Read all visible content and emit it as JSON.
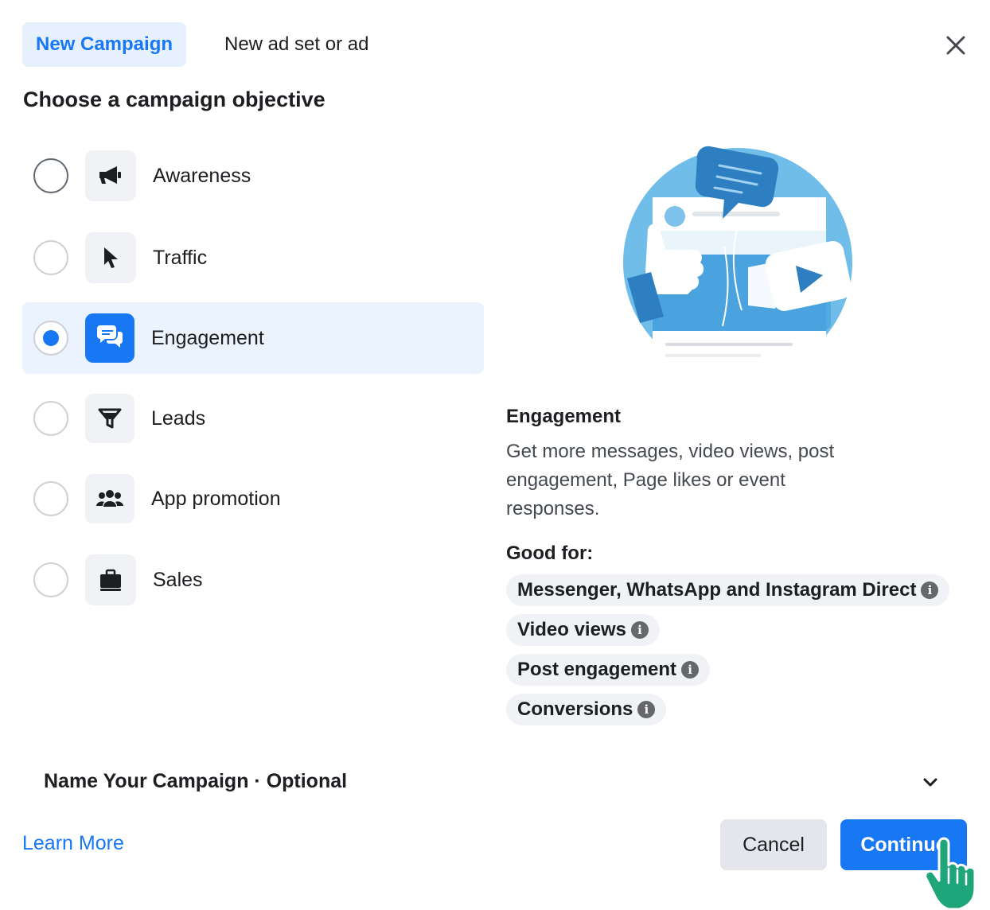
{
  "tabs": {
    "active": "New Campaign",
    "inactive": "New ad set or ad"
  },
  "close_icon": "close-icon",
  "heading": "Choose a campaign objective",
  "objectives": [
    {
      "label": "Awareness",
      "icon": "megaphone-icon",
      "selected": false
    },
    {
      "label": "Traffic",
      "icon": "cursor-icon",
      "selected": false
    },
    {
      "label": "Engagement",
      "icon": "chat-bubbles-icon",
      "selected": true
    },
    {
      "label": "Leads",
      "icon": "funnel-icon",
      "selected": false
    },
    {
      "label": "App promotion",
      "icon": "people-icon",
      "selected": false
    },
    {
      "label": "Sales",
      "icon": "briefcase-icon",
      "selected": false
    }
  ],
  "detail": {
    "title": "Engagement",
    "description": "Get more messages, video views, post engagement, Page likes or event responses.",
    "good_for_label": "Good for:",
    "good_for": [
      "Messenger, WhatsApp and Instagram Direct",
      "Video views",
      "Post engagement",
      "Conversions"
    ]
  },
  "name_campaign": "Name Your Campaign · Optional",
  "learn_more": "Learn More",
  "buttons": {
    "cancel": "Cancel",
    "continue": "Continue"
  },
  "colors": {
    "accent": "#1877f2",
    "selected_bg": "#ebf3fe",
    "cursor": "#1ea67a"
  }
}
